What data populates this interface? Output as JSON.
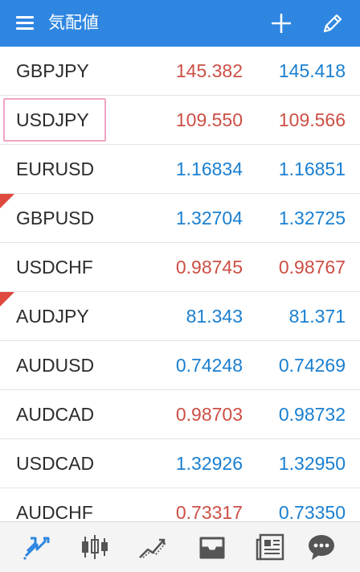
{
  "appbar": {
    "title": "気配値"
  },
  "quotes": [
    {
      "symbol": "GBPJPY",
      "bid": "145.382",
      "ask": "145.418",
      "bid_dir": "down",
      "ask_dir": "up"
    },
    {
      "symbol": "USDJPY",
      "bid": "109.550",
      "ask": "109.566",
      "bid_dir": "down",
      "ask_dir": "down"
    },
    {
      "symbol": "EURUSD",
      "bid": "1.16834",
      "ask": "1.16851",
      "bid_dir": "up",
      "ask_dir": "up"
    },
    {
      "symbol": "GBPUSD",
      "bid": "1.32704",
      "ask": "1.32725",
      "bid_dir": "up",
      "ask_dir": "up"
    },
    {
      "symbol": "USDCHF",
      "bid": "0.98745",
      "ask": "0.98767",
      "bid_dir": "down",
      "ask_dir": "down"
    },
    {
      "symbol": "AUDJPY",
      "bid": "81.343",
      "ask": "81.371",
      "bid_dir": "up",
      "ask_dir": "up"
    },
    {
      "symbol": "AUDUSD",
      "bid": "0.74248",
      "ask": "0.74269",
      "bid_dir": "up",
      "ask_dir": "up"
    },
    {
      "symbol": "AUDCAD",
      "bid": "0.98703",
      "ask": "0.98732",
      "bid_dir": "down",
      "ask_dir": "up"
    },
    {
      "symbol": "USDCAD",
      "bid": "1.32926",
      "ask": "1.32950",
      "bid_dir": "up",
      "ask_dir": "up"
    },
    {
      "symbol": "AUDCHF",
      "bid": "0.73317",
      "ask": "0.73350",
      "bid_dir": "down",
      "ask_dir": "up"
    }
  ],
  "bottom_nav": [
    {
      "icon": "quotes-icon",
      "active": true
    },
    {
      "icon": "chart-icon",
      "active": false
    },
    {
      "icon": "trade-icon",
      "active": false
    },
    {
      "icon": "history-icon",
      "active": false
    },
    {
      "icon": "news-icon",
      "active": false
    },
    {
      "icon": "messages-icon",
      "active": false
    }
  ],
  "colors": {
    "appbar": "#2e86e0",
    "price_up": "#1a7fd0",
    "price_down": "#cc4f45",
    "nav_active": "#2e86e0",
    "nav_inactive": "#555555",
    "highlight": "#f0a5c5",
    "corner_mark": "#e0493e"
  }
}
